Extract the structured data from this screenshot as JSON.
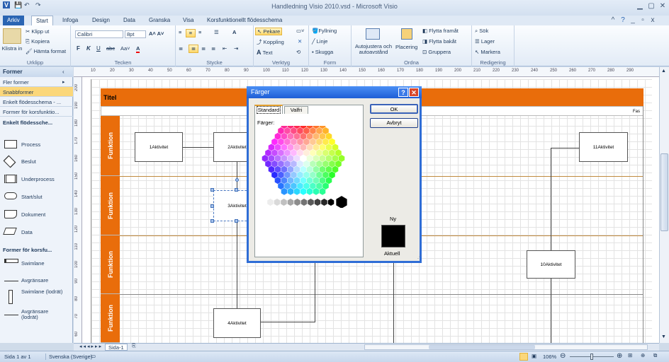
{
  "window": {
    "title": "Handledning Visio 2010.vsd - Microsoft Visio"
  },
  "tabs": [
    "Arkiv",
    "Start",
    "Infoga",
    "Design",
    "Data",
    "Granska",
    "Visa",
    "Korsfunktionellt flödesschema"
  ],
  "ribbon": {
    "clipboard": {
      "paste": "Klistra in",
      "cut": "Klipp ut",
      "copy": "Kopiera",
      "format": "Hämta format",
      "label": "Urklipp"
    },
    "font": {
      "name": "Calibri",
      "size": "8pt",
      "label": "Tecken"
    },
    "paragraph": {
      "label": "Stycke"
    },
    "tools": {
      "pointer": "Pekare",
      "connector": "Koppling",
      "text": "Text",
      "label": "Verktyg"
    },
    "shape": {
      "fill": "Fyllning",
      "line": "Linje",
      "shadow": "Skugga",
      "label": "Form"
    },
    "arrange": {
      "auto": "Autojustera och autoavstånd",
      "position": "Placering",
      "front": "Flytta framåt",
      "back": "Flytta bakåt",
      "group": "Gruppera",
      "label": "Ordna"
    },
    "editing": {
      "find": "Sök",
      "layers": "Lager",
      "select": "Markera",
      "label": "Redigering"
    }
  },
  "leftpane": {
    "title": "Former",
    "items": [
      "Fler former",
      "Snabbformer",
      "Enkelt flödesschema - ...",
      "Former för korsfunktio..."
    ],
    "section1": "Enkelt flödessche...",
    "shapes1": [
      "Process",
      "Beslut",
      "Underprocess",
      "Start/slut",
      "Dokument",
      "Data"
    ],
    "section2": "Former för korsfu...",
    "shapes2": [
      "Swimlane",
      "Avgränsare",
      "Swimlane (lodrät)",
      "Avgränsare (lodrät)"
    ]
  },
  "ruler": {
    "h": [
      "10",
      "20",
      "30",
      "40",
      "50",
      "60",
      "70",
      "80",
      "90",
      "100",
      "110",
      "120",
      "130",
      "140",
      "150",
      "160",
      "170",
      "180",
      "190",
      "200",
      "210",
      "220",
      "230",
      "240",
      "250",
      "260",
      "270",
      "280",
      "290"
    ],
    "v": [
      "200",
      "190",
      "180",
      "170",
      "160",
      "150",
      "140",
      "130",
      "120",
      "110",
      "100",
      "90",
      "80",
      "70",
      "60"
    ]
  },
  "diagram": {
    "title": "Titel",
    "phase": "Fas",
    "lanes": [
      "Funktion",
      "Funktion",
      "Funktion",
      "Funktion"
    ],
    "boxes": [
      {
        "num": "1",
        "text": "Aktivitet"
      },
      {
        "num": "2",
        "text": "Aktivitet"
      },
      {
        "num": "3",
        "text": "Aktivitet"
      },
      {
        "num": "4",
        "text": "Aktivitet"
      },
      {
        "num": "10",
        "text": "Aktivitet"
      },
      {
        "num": "11",
        "text": "Aktivitet"
      }
    ]
  },
  "dialog": {
    "title": "Färger",
    "tab_standard": "Standard",
    "tab_custom": "Valfri",
    "colors_label": "Färger:",
    "ok": "OK",
    "cancel": "Avbryt",
    "new_label": "Ny",
    "current_label": "Aktuell",
    "preview_color": "#000000"
  },
  "pagetab": "Sida-1",
  "status": {
    "page": "Sida 1 av 1",
    "language": "Svenska (Sverige)",
    "zoom": "106%"
  }
}
